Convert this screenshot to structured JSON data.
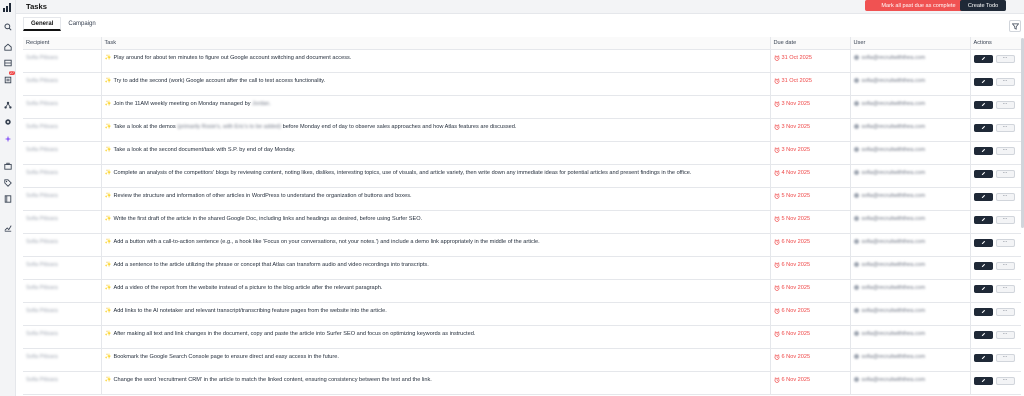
{
  "header": {
    "title": "Tasks",
    "mark_past_due_label": "Mark all past due as complete",
    "create_todo_label": "Create Todo"
  },
  "sidebar": {
    "badge_count": "27",
    "icons": [
      "logo-icon",
      "search-icon",
      "home-icon",
      "inbox-icon",
      "tasks-icon",
      "network-icon",
      "settings-icon",
      "sparkle-icon",
      "briefcase-icon",
      "tag-icon",
      "book-icon",
      "analytics-icon"
    ]
  },
  "tabs": [
    {
      "label": "General",
      "active": true
    },
    {
      "label": "Campaign",
      "active": false
    }
  ],
  "table": {
    "columns": [
      "Recipient",
      "Task",
      "Due date",
      "User",
      "Actions"
    ],
    "rows": [
      {
        "recipient": "Sofia Pitisara",
        "task": "Play around for about ten minutes to figure out Google account switching and document access.",
        "due": "31 Oct 2025",
        "user": "sofia@recruitwiththea.com"
      },
      {
        "recipient": "Sofia Pitisara",
        "task": "Try to add the second (work) Google account after the call to test access functionality.",
        "due": "31 Oct 2025",
        "user": "sofia@recruitwiththea.com"
      },
      {
        "recipient": "Sofia Pitisara",
        "task": "Join the 11AM weekly meeting on Monday managed by",
        "task_blur": "Jordan.",
        "due": "3 Nov 2025",
        "user": "sofia@recruitwiththea.com"
      },
      {
        "recipient": "Sofia Pitisara",
        "task": "Take a look at the demos",
        "task_blur": "(primarily Rosie's, with Eric's to be added)",
        "task_after": "before Monday end of day to observe sales approaches and how Atlas features are discussed.",
        "due": "3 Nov 2025",
        "user": "sofia@recruitwiththea.com"
      },
      {
        "recipient": "Sofia Pitisara",
        "task": "Take a look at the second document/task with S.P. by end of day Monday.",
        "due": "3 Nov 2025",
        "user": "sofia@recruitwiththea.com"
      },
      {
        "recipient": "Sofia Pitisara",
        "task": "Complete an analysis of the competitors' blogs by reviewing content, noting likes, dislikes, interesting topics, use of visuals, and article variety, then write down any immediate ideas for potential articles and present findings in the office.",
        "due": "4 Nov 2025",
        "user": "sofia@recruitwiththea.com"
      },
      {
        "recipient": "Sofia Pitisara",
        "task": "Review the structure and information of other articles in WordPress to understand the organization of buttons and boxes.",
        "due": "5 Nov 2025",
        "user": "sofia@recruitwiththea.com"
      },
      {
        "recipient": "Sofia Pitisara",
        "task": "Write the first draft of the article in the shared Google Doc, including links and headings as desired, before using Surfer SEO.",
        "due": "5 Nov 2025",
        "user": "sofia@recruitwiththea.com"
      },
      {
        "recipient": "Sofia Pitisara",
        "task": "Add a button with a call-to-action sentence (e.g., a hook like 'Focus on your conversations, not your notes.') and include a demo link appropriately in the middle of the article.",
        "due": "6 Nov 2025",
        "user": "sofia@recruitwiththea.com"
      },
      {
        "recipient": "Sofia Pitisara",
        "task": "Add a sentence to the article utilizing the phrase or concept that Atlas can transform audio and video recordings into transcripts.",
        "due": "6 Nov 2025",
        "user": "sofia@recruitwiththea.com"
      },
      {
        "recipient": "Sofia Pitisara",
        "task": "Add a video of the report from the website instead of a picture to the blog article after the relevant paragraph.",
        "due": "6 Nov 2025",
        "user": "sofia@recruitwiththea.com"
      },
      {
        "recipient": "Sofia Pitisara",
        "task": "Add links to the AI notetaker and relevant transcript/transcribing feature pages from the website into the article.",
        "due": "6 Nov 2025",
        "user": "sofia@recruitwiththea.com"
      },
      {
        "recipient": "Sofia Pitisara",
        "task": "After making all text and link changes in the document, copy and paste the article into Surfer SEO and focus on optimizing keywords as instructed.",
        "due": "6 Nov 2025",
        "user": "sofia@recruitwiththea.com"
      },
      {
        "recipient": "Sofia Pitisara",
        "task": "Bookmark the Google Search Console page to ensure direct and easy access in the future.",
        "due": "6 Nov 2025",
        "user": "sofia@recruitwiththea.com"
      },
      {
        "recipient": "Sofia Pitisara",
        "task": "Change the word 'recruitment CRM' in the article to match the linked content, ensuring consistency between the text and the link.",
        "due": "6 Nov 2025",
        "user": "sofia@recruitwiththea.com"
      }
    ],
    "more_label": "···"
  },
  "colors": {
    "accent_red": "#f05252",
    "dark_button": "#1f2937",
    "due_text": "#ef4444"
  }
}
